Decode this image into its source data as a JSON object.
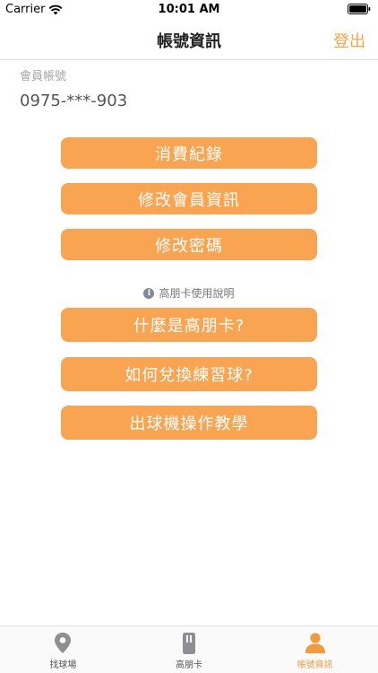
{
  "status_bar": {
    "carrier": "Carrier",
    "time": "10:01 AM"
  },
  "nav": {
    "title": "帳號資訊",
    "logout_label": "登出"
  },
  "account": {
    "label": "會員帳號",
    "value": "0975-***-903"
  },
  "actions": {
    "consumption_record": "消費紀錄",
    "edit_member_info": "修改會員資訊",
    "change_password": "修改密碼"
  },
  "card_help": {
    "title": "高朋卡使用說明",
    "what_is_card": "什麼是高朋卡?",
    "how_to_redeem": "如何兌換練習球?",
    "machine_tutorial": "出球機操作教學"
  },
  "tabs": [
    {
      "label": "找球場",
      "icon": "map-pin-icon",
      "active": false
    },
    {
      "label": "高朋卡",
      "icon": "card-icon",
      "active": false
    },
    {
      "label": "帳號資訊",
      "icon": "person-icon",
      "active": true
    }
  ],
  "colors": {
    "accent": "#f9a450",
    "logout": "#f7a44a",
    "active_tab": "#f39a3c",
    "inactive_icon": "#8e8e93"
  }
}
